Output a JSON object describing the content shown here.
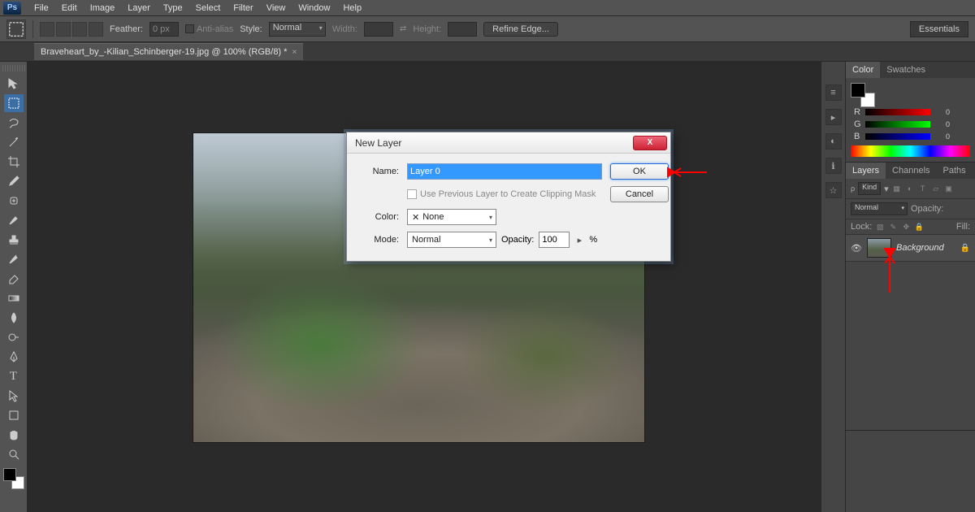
{
  "menu": {
    "items": [
      "File",
      "Edit",
      "Image",
      "Layer",
      "Type",
      "Select",
      "Filter",
      "View",
      "Window",
      "Help"
    ]
  },
  "options": {
    "feather_label": "Feather:",
    "feather_value": "0 px",
    "antialias": "Anti-alias",
    "style_label": "Style:",
    "style_value": "Normal",
    "width_label": "Width:",
    "height_label": "Height:",
    "refine": "Refine Edge...",
    "workspace": "Essentials"
  },
  "doc_tab": "Braveheart_by_-Kilian_Schinberger-19.jpg @ 100% (RGB/8) *",
  "panels": {
    "color_tab": "Color",
    "swatches_tab": "Swatches",
    "r": "R",
    "g": "G",
    "b": "B",
    "r_val": "0",
    "g_val": "0",
    "b_val": "0",
    "layers_tab": "Layers",
    "channels_tab": "Channels",
    "paths_tab": "Paths",
    "kind": "Kind",
    "blend": "Normal",
    "opacity_label": "Opacity:",
    "lock_label": "Lock:",
    "fill_label": "Fill:",
    "bg_layer": "Background"
  },
  "dialog": {
    "title": "New Layer",
    "name_label": "Name:",
    "name_value": "Layer 0",
    "use_prev": "Use Previous Layer to Create Clipping Mask",
    "color_label": "Color:",
    "color_value": "None",
    "mode_label": "Mode:",
    "mode_value": "Normal",
    "opacity_label": "Opacity:",
    "opacity_value": "100",
    "opacity_unit": "%",
    "ok": "OK",
    "cancel": "Cancel"
  }
}
